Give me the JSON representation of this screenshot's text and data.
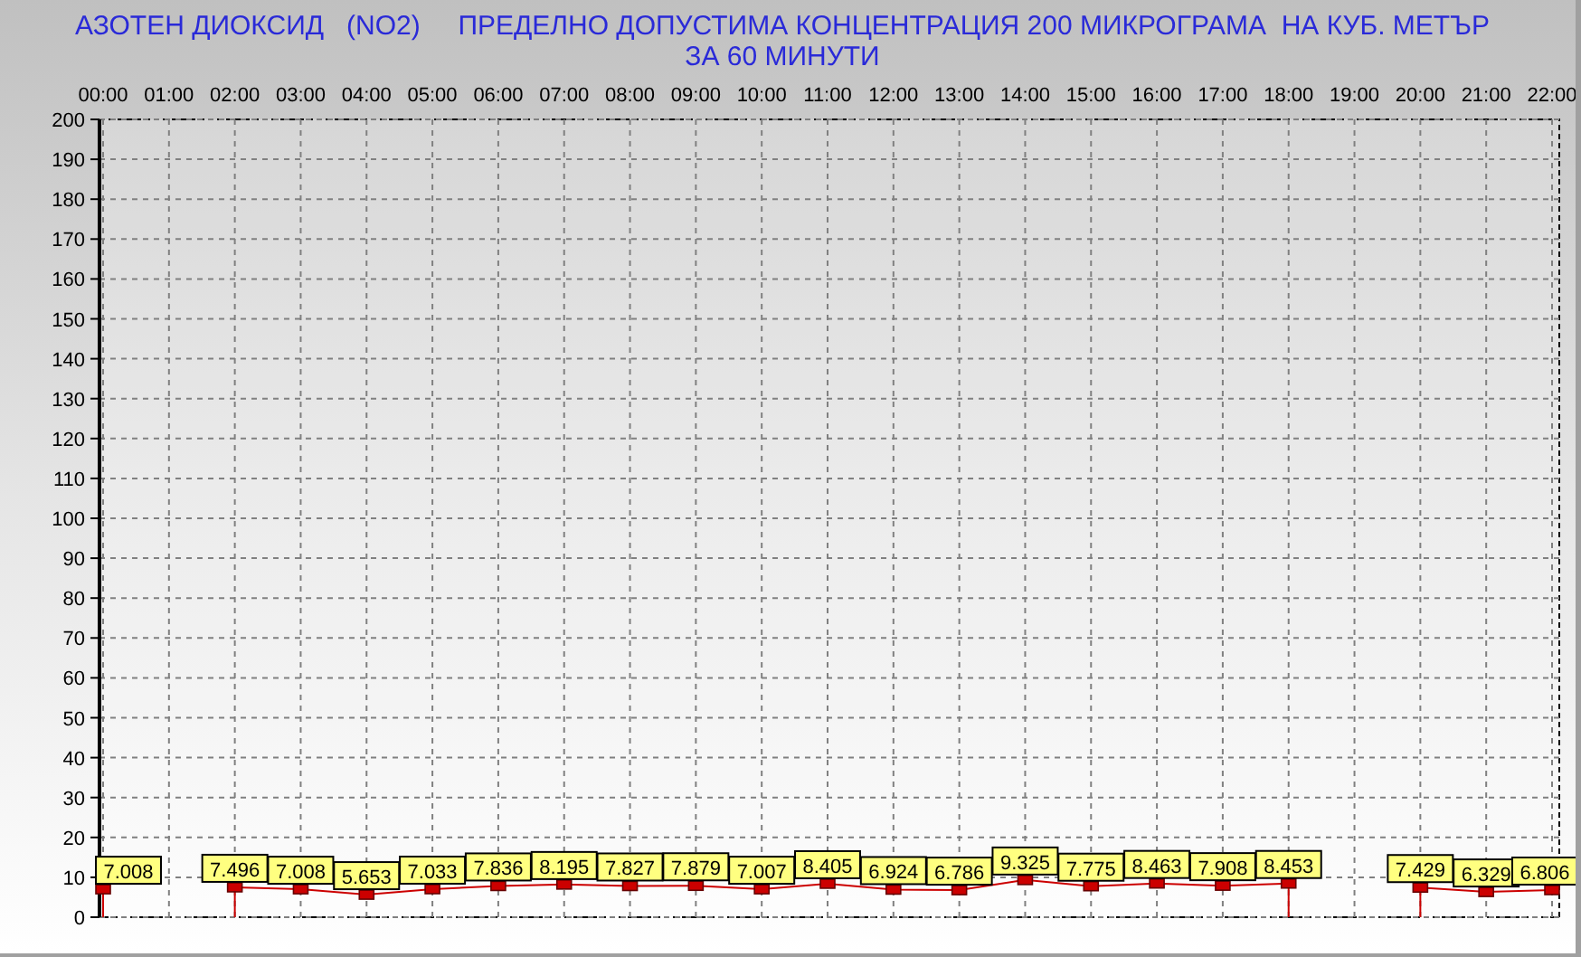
{
  "title_lines": [
    "АЗОТЕН ДИОКСИД   (NO2)     ПРЕДЕЛНО ДОПУСТИМА КОНЦЕНТРАЦИЯ 200 МИКРОГРАМА  НА КУБ. МЕТЪР",
    "ЗА 60 МИНУТИ"
  ],
  "chart_data": {
    "type": "line",
    "categories": [
      "00:00",
      "01:00",
      "02:00",
      "03:00",
      "04:00",
      "05:00",
      "06:00",
      "07:00",
      "08:00",
      "09:00",
      "10:00",
      "11:00",
      "12:00",
      "13:00",
      "14:00",
      "15:00",
      "16:00",
      "17:00",
      "18:00",
      "19:00",
      "20:00",
      "21:00",
      "22:00"
    ],
    "series": [
      {
        "color": "#cc0000",
        "marker": "square",
        "values": [
          7.008,
          null,
          7.496,
          7.008,
          5.653,
          7.033,
          7.836,
          8.195,
          7.827,
          7.879,
          7.007,
          8.405,
          6.924,
          6.786,
          9.325,
          7.775,
          8.463,
          7.908,
          8.453,
          null,
          7.429,
          6.329,
          6.806
        ]
      }
    ],
    "ylim": [
      0,
      200
    ],
    "yticks": [
      0,
      10,
      20,
      30,
      40,
      50,
      60,
      70,
      80,
      90,
      100,
      110,
      120,
      130,
      140,
      150,
      160,
      170,
      180,
      190,
      200
    ],
    "grid": true,
    "value_labels": [
      "7.008",
      null,
      "7.496",
      "7.008",
      "5.653",
      "7.033",
      "7.836",
      "8.195",
      "7.827",
      "7.879",
      "7.007",
      "8.405",
      "6.924",
      "6.786",
      "9.325",
      "7.775",
      "8.463",
      "7.908",
      "8.453",
      null,
      "7.429",
      "6.329",
      "6.806"
    ]
  }
}
